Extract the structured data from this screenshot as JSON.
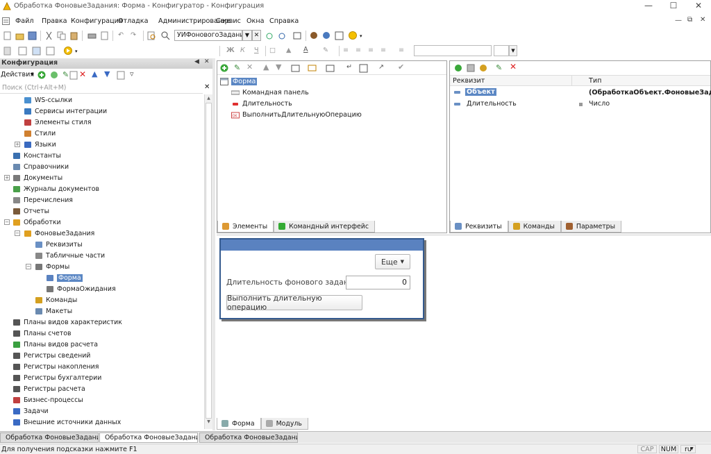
{
  "window": {
    "title": "Обработка ФоновыеЗадания: Форма - Конфигуратор - Конфигурация"
  },
  "menu": [
    "Файл",
    "Правка",
    "Конфигурация",
    "Отладка",
    "Администрирование",
    "Сервис",
    "Окна",
    "Справка"
  ],
  "toolbar": {
    "combo_value": "УИФоновогоЗадания"
  },
  "left": {
    "header": "Конфигурация",
    "actions_label": "Действия",
    "search_placeholder": "Поиск (Ctrl+Alt+M)",
    "tree": [
      {
        "label": "WS-ссылки",
        "icon": "ws-icon"
      },
      {
        "label": "Сервисы интеграции",
        "icon": "integration-icon"
      },
      {
        "label": "Элементы стиля",
        "icon": "style-element-icon"
      },
      {
        "label": "Стили",
        "icon": "style-icon"
      },
      {
        "label": "Языки",
        "icon": "language-icon"
      },
      {
        "label": "Константы",
        "icon": "constant-icon"
      },
      {
        "label": "Справочники",
        "icon": "catalog-icon"
      },
      {
        "label": "Документы",
        "icon": "document-icon"
      },
      {
        "label": "Журналы документов",
        "icon": "journal-icon"
      },
      {
        "label": "Перечисления",
        "icon": "enum-icon"
      },
      {
        "label": "Отчеты",
        "icon": "report-icon"
      },
      {
        "label": "Обработки",
        "icon": "dataprocessor-icon"
      },
      {
        "label": "ФоновыеЗадания",
        "icon": "dataprocessor-icon"
      },
      {
        "label": "Реквизиты",
        "icon": "attribute-icon"
      },
      {
        "label": "Табличные части",
        "icon": "table-icon"
      },
      {
        "label": "Формы",
        "icon": "form-icon"
      },
      {
        "label": "Форма",
        "icon": "form-icon"
      },
      {
        "label": "ФормаОжидания",
        "icon": "form-icon"
      },
      {
        "label": "Команды",
        "icon": "command-icon"
      },
      {
        "label": "Макеты",
        "icon": "template-icon"
      },
      {
        "label": "Планы видов характеристик",
        "icon": "chart-types-icon"
      },
      {
        "label": "Планы счетов",
        "icon": "accounts-icon"
      },
      {
        "label": "Планы видов расчета",
        "icon": "calc-types-icon"
      },
      {
        "label": "Регистры сведений",
        "icon": "info-register-icon"
      },
      {
        "label": "Регистры накопления",
        "icon": "accum-register-icon"
      },
      {
        "label": "Регистры бухгалтерии",
        "icon": "acc-register-icon"
      },
      {
        "label": "Регистры расчета",
        "icon": "calc-register-icon"
      },
      {
        "label": "Бизнес-процессы",
        "icon": "bp-icon"
      },
      {
        "label": "Задачи",
        "icon": "task-icon"
      },
      {
        "label": "Внешние источники данных",
        "icon": "ext-source-icon"
      }
    ]
  },
  "elements": {
    "root": "Форма",
    "items": [
      "Командная панель",
      "Длительность",
      "ВыполнитьДлительнуюОперацию"
    ],
    "tabs": [
      "Элементы",
      "Командный интерфейс"
    ]
  },
  "attributes": {
    "col_name": "Реквизит",
    "col_type": "Тип",
    "rows": [
      {
        "name": "Объект",
        "type": "(ОбработкаОбъект.ФоновыеЗад..."
      },
      {
        "name": "Длительность",
        "type": "Число"
      }
    ],
    "tabs": [
      "Реквизиты",
      "Команды",
      "Параметры"
    ]
  },
  "preview": {
    "more_label": "Еще",
    "field_label": "Длительность фонового задания:",
    "field_value": "0",
    "run_label": "Выполнить длительную операцию"
  },
  "bottom_tabs": [
    "Форма",
    "Модуль"
  ],
  "windows": [
    "Обработка ФоновыеЗадани...",
    "Обработка ФоновыеЗадани...",
    "Обработка ФоновыеЗадани..."
  ],
  "status": {
    "hint": "Для получения подсказки нажмите F1",
    "cap": "CAP",
    "num": "NUM",
    "lang": "ru"
  }
}
